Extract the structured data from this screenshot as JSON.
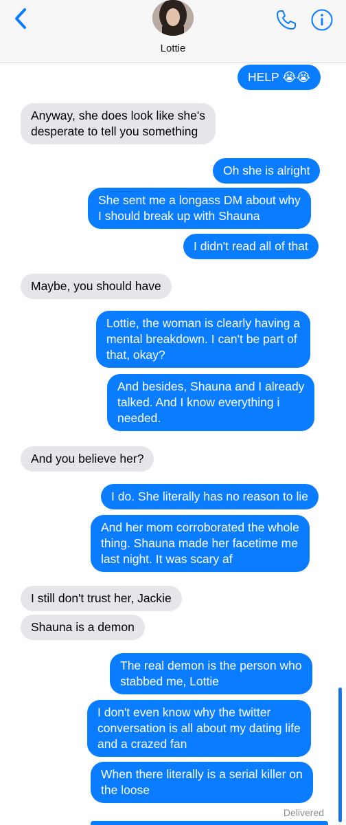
{
  "header": {
    "contact_name": "Lottie"
  },
  "messages": [
    {
      "from": "me",
      "text": "HELP 😭😭"
    },
    {
      "from": "them",
      "text": "Anyway, she does look like she's\ndesperate to tell you something"
    },
    {
      "from": "me",
      "text": "Oh she is alright"
    },
    {
      "from": "me",
      "text": "She sent me a longass DM about why\nI should break up with Shauna"
    },
    {
      "from": "me",
      "text": "I didn't read all of that"
    },
    {
      "from": "them",
      "text": "Maybe, you should have"
    },
    {
      "from": "me",
      "text": "Lottie, the woman is clearly having a\nmental breakdown. I can't be part of\nthat, okay?"
    },
    {
      "from": "me",
      "text": "And besides, Shauna and I already\ntalked. And I know everything i\nneeded."
    },
    {
      "from": "them",
      "text": "And you believe her?"
    },
    {
      "from": "me",
      "text": "I do. She literally has no reason to lie"
    },
    {
      "from": "me",
      "text": "And her mom corroborated the whole\nthing. Shauna made her facetime me\nlast night. It was scary af"
    },
    {
      "from": "them",
      "text": "I still don't trust her, Jackie"
    },
    {
      "from": "them",
      "text": "Shauna is a demon"
    },
    {
      "from": "me",
      "text": "The real demon is the person who\nstabbed me, Lottie"
    },
    {
      "from": "me",
      "text": "I don't even know why the twitter\nconversation is all about my dating life\nand a crazed fan"
    },
    {
      "from": "me",
      "text": "When there literally is a serial killer on\nthe loose"
    }
  ],
  "status": {
    "delivered": "Delivered"
  },
  "colors": {
    "outgoing_bubble": "#0a7cff",
    "incoming_bubble": "#e5e5ea",
    "accent": "#0a7cff"
  },
  "icons": [
    "chevron-left-icon",
    "phone-icon",
    "info-icon"
  ]
}
